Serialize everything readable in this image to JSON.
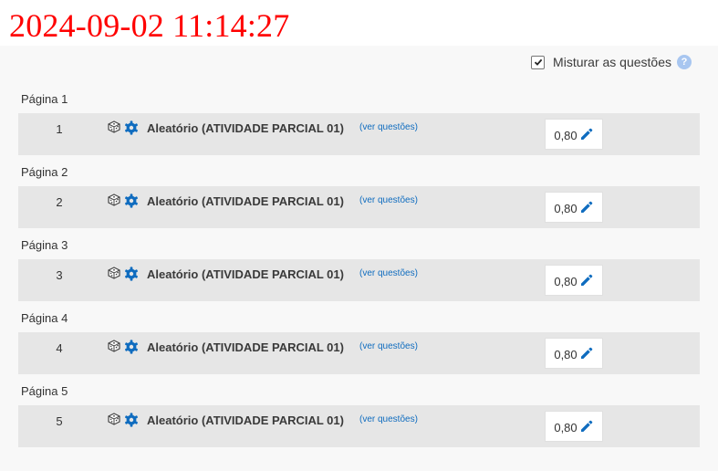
{
  "timestamp": "2024-09-02 11:14:27",
  "shuffle": {
    "label": "Misturar as questões",
    "checked": true,
    "help_icon": "question-circle-icon"
  },
  "pages": [
    {
      "page_label": "Página 1",
      "slot_number": "1",
      "question_name": "Aleatório (ATIVIDADE PARCIAL 01)",
      "view_link": "(ver questões)",
      "mark": "0,80"
    },
    {
      "page_label": "Página 2",
      "slot_number": "2",
      "question_name": "Aleatório (ATIVIDADE PARCIAL 01)",
      "view_link": "(ver questões)",
      "mark": "0,80"
    },
    {
      "page_label": "Página 3",
      "slot_number": "3",
      "question_name": "Aleatório (ATIVIDADE PARCIAL 01)",
      "view_link": "(ver questões)",
      "mark": "0,80"
    },
    {
      "page_label": "Página 4",
      "slot_number": "4",
      "question_name": "Aleatório (ATIVIDADE PARCIAL 01)",
      "view_link": "(ver questões)",
      "mark": "0,80"
    },
    {
      "page_label": "Página 5",
      "slot_number": "5",
      "question_name": "Aleatório (ATIVIDADE PARCIAL 01)",
      "view_link": "(ver questões)",
      "mark": "0,80"
    }
  ],
  "colors": {
    "timestamp": "#ff0000",
    "accent": "#0f6cbf",
    "slot_background": "#e6e6e6"
  },
  "icons": {
    "random": "dice-icon",
    "settings": "gear-icon",
    "edit": "pencil-icon"
  }
}
